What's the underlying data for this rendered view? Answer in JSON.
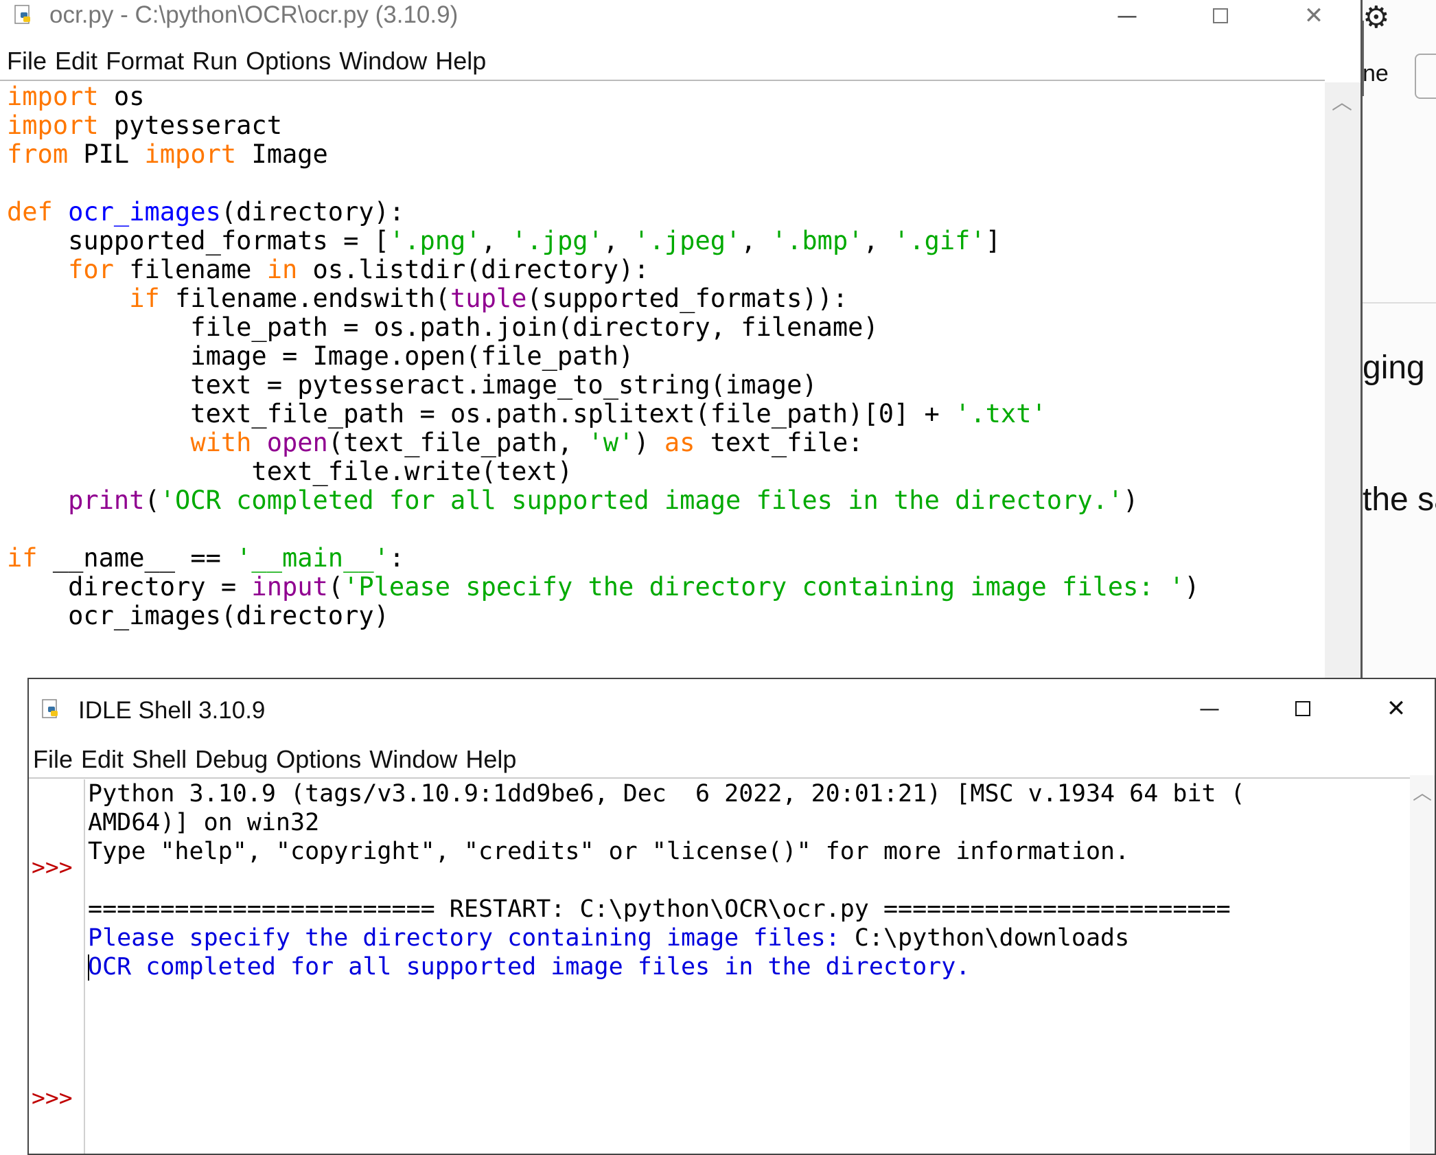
{
  "editor": {
    "title": "ocr.py - C:\\python\\OCR\\ocr.py (3.10.9)",
    "menu": [
      "File",
      "Edit",
      "Format",
      "Run",
      "Options",
      "Window",
      "Help"
    ],
    "code": [
      [
        {
          "t": "import",
          "c": "kw"
        },
        {
          "t": " os"
        }
      ],
      [
        {
          "t": "import",
          "c": "kw"
        },
        {
          "t": " pytesseract"
        }
      ],
      [
        {
          "t": "from",
          "c": "kw"
        },
        {
          "t": " PIL "
        },
        {
          "t": "import",
          "c": "kw"
        },
        {
          "t": " Image"
        }
      ],
      [],
      [
        {
          "t": "def",
          "c": "kw"
        },
        {
          "t": " "
        },
        {
          "t": "ocr_images",
          "c": "fn"
        },
        {
          "t": "(directory):"
        }
      ],
      [
        {
          "t": "    supported_formats = ["
        },
        {
          "t": "'.png'",
          "c": "st"
        },
        {
          "t": ", "
        },
        {
          "t": "'.jpg'",
          "c": "st"
        },
        {
          "t": ", "
        },
        {
          "t": "'.jpeg'",
          "c": "st"
        },
        {
          "t": ", "
        },
        {
          "t": "'.bmp'",
          "c": "st"
        },
        {
          "t": ", "
        },
        {
          "t": "'.gif'",
          "c": "st"
        },
        {
          "t": "]"
        }
      ],
      [
        {
          "t": "    "
        },
        {
          "t": "for",
          "c": "kw"
        },
        {
          "t": " filename "
        },
        {
          "t": "in",
          "c": "kw"
        },
        {
          "t": " os.listdir(directory):"
        }
      ],
      [
        {
          "t": "        "
        },
        {
          "t": "if",
          "c": "kw"
        },
        {
          "t": " filename.endswith("
        },
        {
          "t": "tuple",
          "c": "bi"
        },
        {
          "t": "(supported_formats)):"
        }
      ],
      [
        {
          "t": "            file_path = os.path.join(directory, filename)"
        }
      ],
      [
        {
          "t": "            image = Image.open(file_path)"
        }
      ],
      [
        {
          "t": "            text = pytesseract.image_to_string(image)"
        }
      ],
      [
        {
          "t": "            text_file_path = os.path.splitext(file_path)[0] + "
        },
        {
          "t": "'.txt'",
          "c": "st"
        }
      ],
      [
        {
          "t": "            "
        },
        {
          "t": "with",
          "c": "kw"
        },
        {
          "t": " "
        },
        {
          "t": "open",
          "c": "bi"
        },
        {
          "t": "(text_file_path, "
        },
        {
          "t": "'w'",
          "c": "st"
        },
        {
          "t": ") "
        },
        {
          "t": "as",
          "c": "kw"
        },
        {
          "t": " text_file:"
        }
      ],
      [
        {
          "t": "                text_file.write(text)"
        }
      ],
      [
        {
          "t": "    "
        },
        {
          "t": "print",
          "c": "bi"
        },
        {
          "t": "("
        },
        {
          "t": "'OCR completed for all supported image files in the directory.'",
          "c": "st"
        },
        {
          "t": ")"
        }
      ],
      [],
      [
        {
          "t": "if",
          "c": "kw"
        },
        {
          "t": " __name__ == "
        },
        {
          "t": "'__main__'",
          "c": "st"
        },
        {
          "t": ":"
        }
      ],
      [
        {
          "t": "    directory = "
        },
        {
          "t": "input",
          "c": "bi"
        },
        {
          "t": "("
        },
        {
          "t": "'Please specify the directory containing image files: '",
          "c": "st"
        },
        {
          "t": ")"
        }
      ],
      [
        {
          "t": "    ocr_images(directory)"
        }
      ]
    ]
  },
  "shell": {
    "title": "IDLE Shell 3.10.9",
    "menu": [
      "File",
      "Edit",
      "Shell",
      "Debug",
      "Options",
      "Window",
      "Help"
    ],
    "prompt": ">>>",
    "banner": [
      "Python 3.10.9 (tags/v3.10.9:1dd9be6, Dec  6 2022, 20:01:21) [MSC v.1934 64 bit (",
      "AMD64)] on win32",
      "Type \"help\", \"copyright\", \"credits\" or \"license()\" for more information."
    ],
    "restart": "======================== RESTART: C:\\python\\OCR\\ocr.py ========================",
    "input_prompt": "Please specify the directory containing image files: ",
    "input_value": "C:\\python\\downloads",
    "output": "OCR completed for all supported image files in the directory."
  },
  "background": {
    "fragments": [
      "ne",
      "ging",
      "the sa"
    ]
  }
}
